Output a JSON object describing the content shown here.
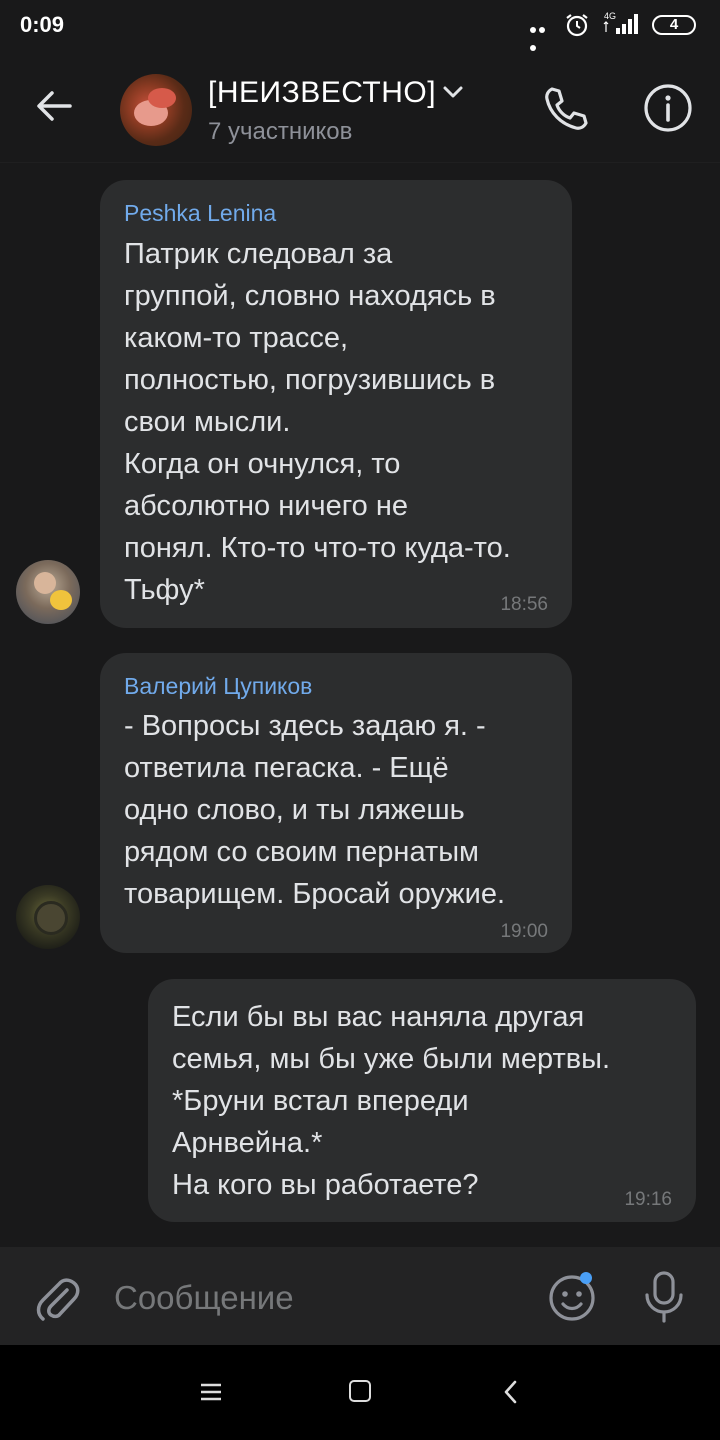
{
  "status_bar": {
    "time": "0:09",
    "network": "4G",
    "battery": "4"
  },
  "header": {
    "title": "[НЕИЗВЕСТНО]",
    "subtitle": "7 участников"
  },
  "messages": [
    {
      "sender": "Peshka Lenina",
      "text": "Патрик следовал за\nгруппой, словно находясь в\nкаком-то трассе,\nполностью, погрузившись в\nсвои мысли.\nКогда он очнулся, то\nабсолютно ничего не\nпонял. Кто-то что-то куда-то.\nТьфу*",
      "time": "18:56"
    },
    {
      "sender": "Валерий Цупиков",
      "text": "- Вопросы здесь задаю я. -\nответила пегаска. - Ещё\nодно слово, и ты ляжешь\nрядом со своим пернатым\nтоварищем. Бросай оружие.",
      "time": "19:00"
    },
    {
      "sender": "",
      "text": "Если бы вы вас наняла другая\nсемья, мы бы уже были мертвы.\n*Бруни встал впереди\nАрнвейна.*\nНа кого вы работаете?",
      "time": "19:16"
    }
  ],
  "composer": {
    "placeholder": "Сообщение"
  },
  "colors": {
    "background": "#19191a",
    "bubble": "#2c2d2e",
    "sender": "#71aaeb",
    "accent": "#4a9ff5"
  }
}
